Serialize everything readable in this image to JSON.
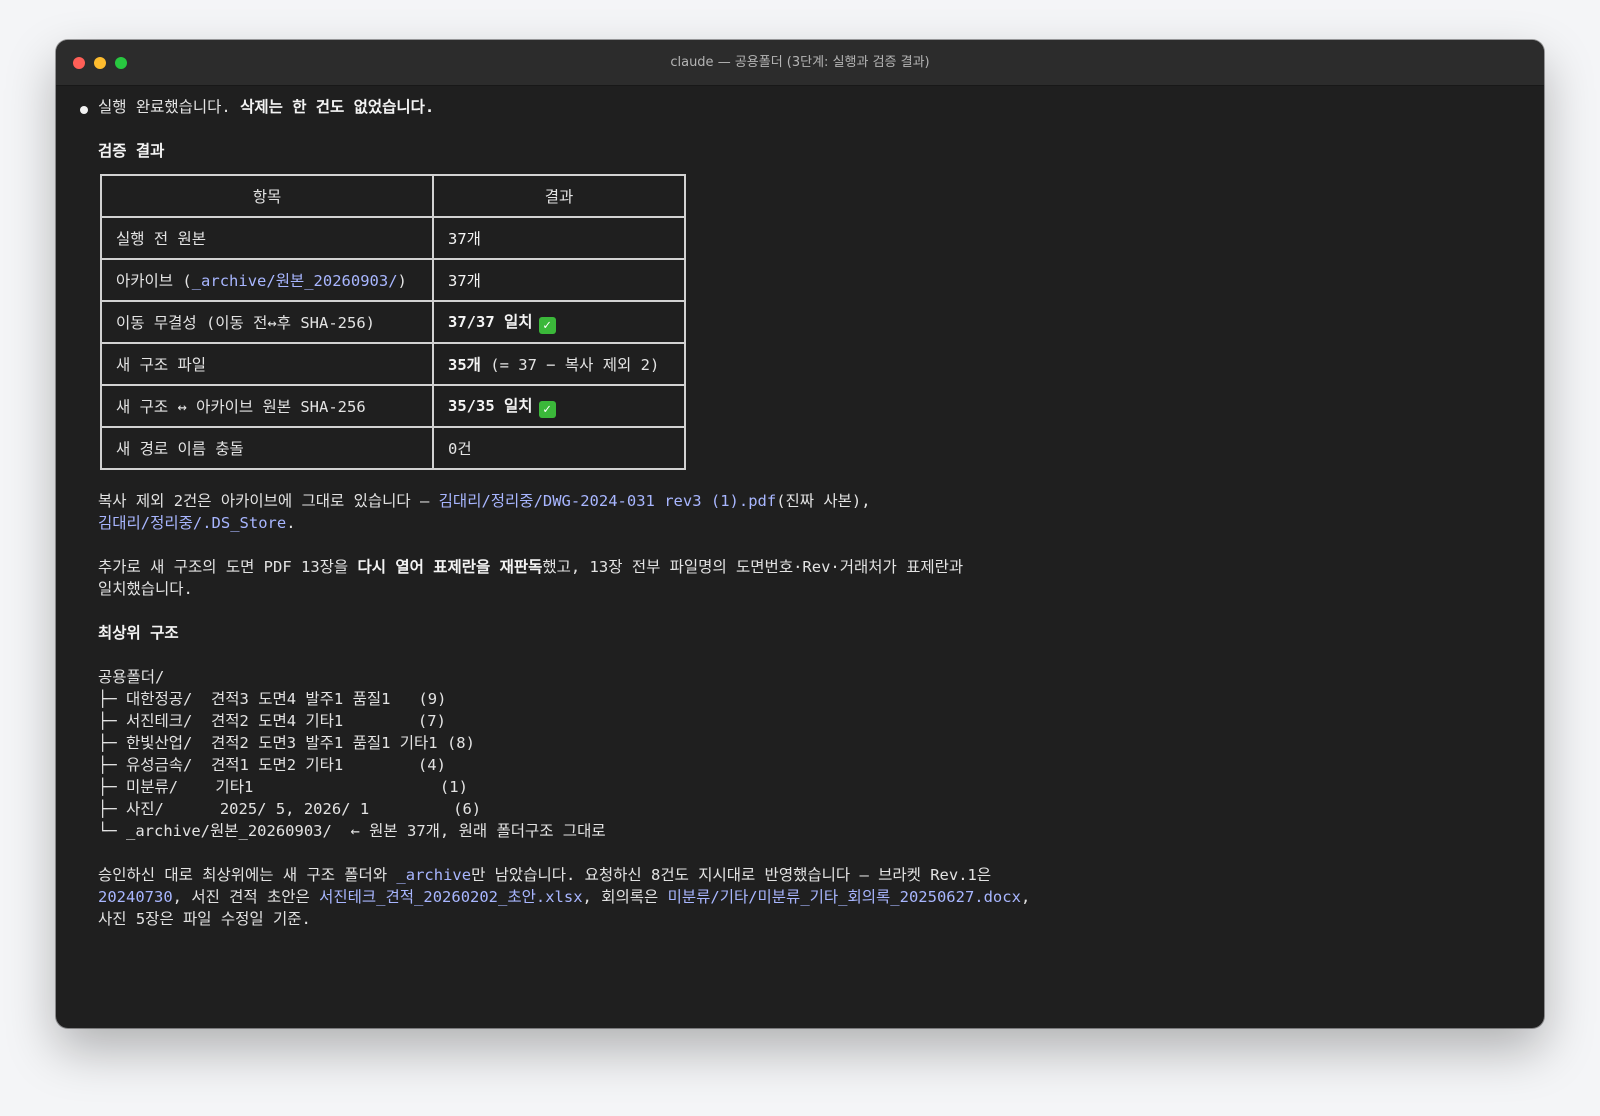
{
  "window": {
    "title": "claude — 공용폴더 (3단계: 실행과 검증 결과)"
  },
  "summary": {
    "prefix": "실행 완료했습니다. ",
    "bold": "삭제는 한 건도 없었습니다."
  },
  "verify": {
    "heading": "검증 결과",
    "headers": [
      "항목",
      "결과"
    ],
    "rows": [
      {
        "item": "실행 전 원본",
        "result": "37개"
      },
      {
        "item_prefix": "아카이브 (",
        "item_link": "_archive/원본_20260903/",
        "item_suffix": ")",
        "result": "37개"
      },
      {
        "item": "이동 무결성 (이동 전↔후 SHA-256)",
        "result": "37/37 일치"
      },
      {
        "item": "새 구조 파일",
        "result_bold": "35개",
        "result_rest": " (= 37 − 복사 제외 2)"
      },
      {
        "item": "새 구조 ↔ 아카이브 원본 SHA-256",
        "result": "35/35 일치"
      },
      {
        "item": "새 경로 이름 충돌",
        "result": "0건"
      }
    ],
    "check_icon": "✓"
  },
  "copy_note": {
    "text1": "복사 제외 2건은 아카이브에 그대로 있습니다 — ",
    "link1": "김대리/정리중/DWG-2024-031 rev3 (1).pdf",
    "text2": "(진짜 사본),",
    "link2": "김대리/정리중/.DS_Store",
    "text3": "."
  },
  "recheck": {
    "text1": "추가로 새 구조의 도면 PDF 13장을 ",
    "bold": "다시 열어 표제란을 재판독",
    "text2": "했고, 13장 전부 파일명의 도면번호·Rev·거래처가 표제란과",
    "line2": "일치했습니다."
  },
  "structure": {
    "heading": "최상위 구조",
    "root": "공용폴더/",
    "lines": [
      "├─ 대한정공/  견적3 도면4 발주1 품질1   (9)",
      "├─ 서진테크/  견적2 도면4 기타1        (7)",
      "├─ 한빛산업/  견적2 도면3 발주1 품질1 기타1 (8)",
      "├─ 유성금속/  견적1 도면2 기타1        (4)",
      "├─ 미분류/    기타1                    (1)",
      "├─ 사진/      2025/ 5, 2026/ 1         (6)",
      "└─ _archive/원본_20260903/  ← 원본 37개, 원래 폴더구조 그대로"
    ]
  },
  "closing": {
    "t1": "승인하신 대로 최상위에는 새 구조 폴더와 ",
    "l1": "_archive",
    "t2": "만 남았습니다. 요청하신 8건도 지시대로 반영했습니다 — 브라켓 Rev.1은",
    "l2": "20240730",
    "t3": ", 서진 견적 초안은 ",
    "l3": "서진테크_견적_20260202_초안.xlsx",
    "t4": ", 회의록은 ",
    "l4": "미분류/기타/미분류_기타_회의록_20250627.docx",
    "t5": ",",
    "line3": "사진 5장은 파일 수정일 기준."
  }
}
